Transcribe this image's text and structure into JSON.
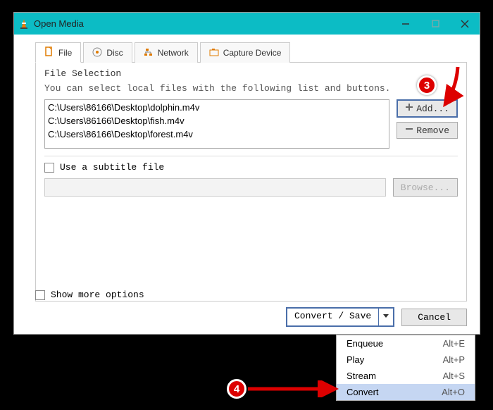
{
  "titlebar": {
    "title": "Open Media"
  },
  "tabs": {
    "file": "File",
    "disc": "Disc",
    "network": "Network",
    "capture": "Capture Device"
  },
  "file_selection": {
    "label": "File Selection",
    "help": "You can select local files with the following list and buttons.",
    "files": [
      "C:\\Users\\86166\\Desktop\\dolphin.m4v",
      "C:\\Users\\86166\\Desktop\\fish.m4v",
      "C:\\Users\\86166\\Desktop\\forest.m4v"
    ],
    "add_label": "Add...",
    "remove_label": "Remove"
  },
  "subtitle": {
    "checkbox_label": "Use a subtitle file",
    "browse_label": "Browse..."
  },
  "show_more": {
    "label": "Show more options"
  },
  "buttons": {
    "convert_save": "Convert / Save",
    "cancel": "Cancel"
  },
  "dropdown": {
    "items": [
      {
        "label": "Enqueue",
        "shortcut": "Alt+E"
      },
      {
        "label": "Play",
        "shortcut": "Alt+P"
      },
      {
        "label": "Stream",
        "shortcut": "Alt+S"
      },
      {
        "label": "Convert",
        "shortcut": "Alt+O"
      }
    ],
    "selected_index": 3
  },
  "annotations": {
    "badge3": "3",
    "badge4": "4"
  }
}
